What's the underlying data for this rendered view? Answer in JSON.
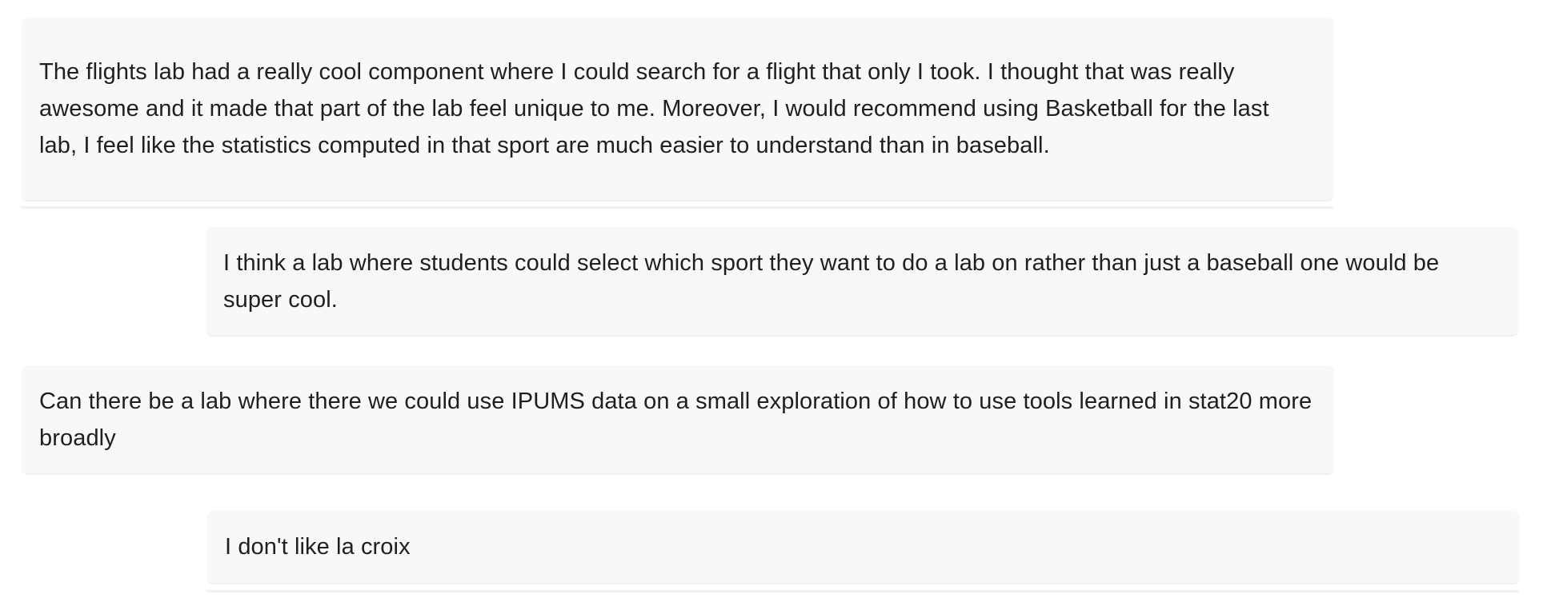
{
  "feed": {
    "items": [
      {
        "text": "The flights lab had a really cool component where I could search for a flight that only I took. I thought that was really awesome and it made that part of the lab feel unique to me. Moreover, I would recommend using Basketball for the last lab, I feel like the statistics computed in that sport are much easier to understand than in baseball."
      },
      {
        "text": "I think a lab where students could select which sport they want to do a lab on rather than just a baseball one would be super cool."
      },
      {
        "text": "Can there be a lab where there we could use IPUMS data on a small exploration of how to use tools learned in stat20 more broadly"
      },
      {
        "text": "I don't like la croix"
      }
    ]
  }
}
